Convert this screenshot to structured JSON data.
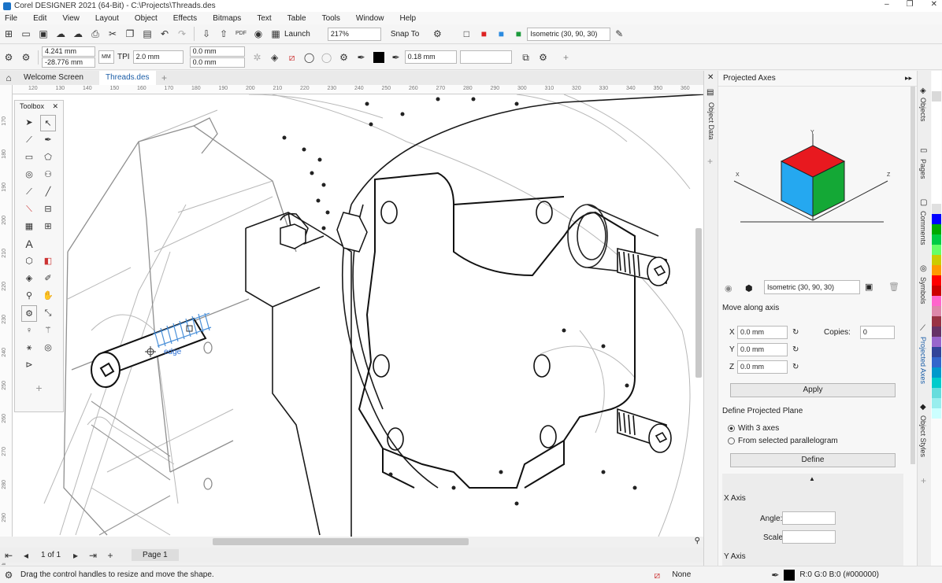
{
  "window": {
    "title": "Corel DESIGNER 2021 (64-Bit) - C:\\Projects\\Threads.des",
    "controls": [
      "–",
      "❐",
      "✕"
    ]
  },
  "menu": [
    "File",
    "Edit",
    "View",
    "Layout",
    "Object",
    "Effects",
    "Bitmaps",
    "Text",
    "Table",
    "Tools",
    "Window",
    "Help"
  ],
  "toolbar1": {
    "launch_label": "Launch",
    "zoom_value": "217%",
    "snap_label": "Snap To",
    "projection_value": "Isometric (30, 90, 30)"
  },
  "toolbar2": {
    "x_value": "4.241 mm",
    "y_value": "-28.776 mm",
    "tpi_label": "TPI",
    "tpi_value": "2.0 mm",
    "offset1": "0.0 mm",
    "offset2": "0.0 mm",
    "stroke_width": "0.18 mm",
    "mm_label": "MM"
  },
  "tabs": [
    {
      "label": "Welcome Screen"
    },
    {
      "label": "Threads.des"
    }
  ],
  "ruler": {
    "h_ticks": [
      "120",
      "130",
      "140",
      "150",
      "160",
      "170",
      "180",
      "190",
      "200",
      "210",
      "220",
      "230",
      "240",
      "250",
      "260",
      "270",
      "280",
      "290",
      "300",
      "310",
      "320",
      "330",
      "340",
      "350",
      "360",
      "millimeters"
    ],
    "v_ticks": [
      "170",
      "180",
      "190",
      "200",
      "210",
      "220",
      "230",
      "240",
      "250",
      "260",
      "270",
      "280",
      "290",
      "millimeters"
    ]
  },
  "toolbox": {
    "title": "Toolbox",
    "close": "✕",
    "add": "+"
  },
  "canvas": {
    "snap_tooltip": "edge"
  },
  "pagebar": {
    "page_counter": "1 of 1",
    "page_tab": "Page 1"
  },
  "status": {
    "hint": "Drag the control handles to resize and move the shape.",
    "fill_label": "None",
    "outline_label": "R:0 G:0 B:0 (#000000)"
  },
  "docker": {
    "title": "Projected Axes",
    "cube_axis_labels": {
      "x": "X",
      "y": "Y",
      "z": "Z"
    },
    "preset_value": "Isometric (30, 90, 30)",
    "move_heading": "Move along axis",
    "x_label": "X",
    "x_value": "0.0 mm",
    "y_label": "Y",
    "y_value": "0.0 mm",
    "z_label": "Z",
    "z_value": "0.0 mm",
    "copies_label": "Copies:",
    "copies_value": "0",
    "apply_label": "Apply",
    "plane_heading": "Define Projected Plane",
    "option_three_axes": "With 3 axes",
    "option_parallelogram": "From selected parallelogram",
    "define_label": "Define",
    "x_axis_heading": "X Axis",
    "angle_label": "Angle:",
    "scale_label": "Scale",
    "y_axis_heading": "Y Axis"
  },
  "sidetabs": [
    "Objects",
    "Pages",
    "Comments",
    "Symbols",
    "Projected Axes",
    "Object Styles"
  ],
  "dock_strip": {
    "label": "Object Data"
  },
  "palette": [
    "#ffffff",
    "#ffffff",
    "#d9d9d9",
    "#ffffff",
    "#ffffff",
    "#ffffff",
    "#ffffff",
    "#ffffff",
    "#ffffff",
    "#ffffff",
    "#ffffff",
    "#ffffff",
    "#ffffff",
    "#e0e0e0",
    "#0000ff",
    "#00aa00",
    "#00cc44",
    "#66ff66",
    "#cccc00",
    "#ff9900",
    "#ff0000",
    "#cc0000",
    "#ff66cc",
    "#dd88aa",
    "#993344",
    "#663366",
    "#9966cc",
    "#334499",
    "#3366cc",
    "#0099cc",
    "#00cccc",
    "#66dddd",
    "#99eeee",
    "#ccffff"
  ]
}
